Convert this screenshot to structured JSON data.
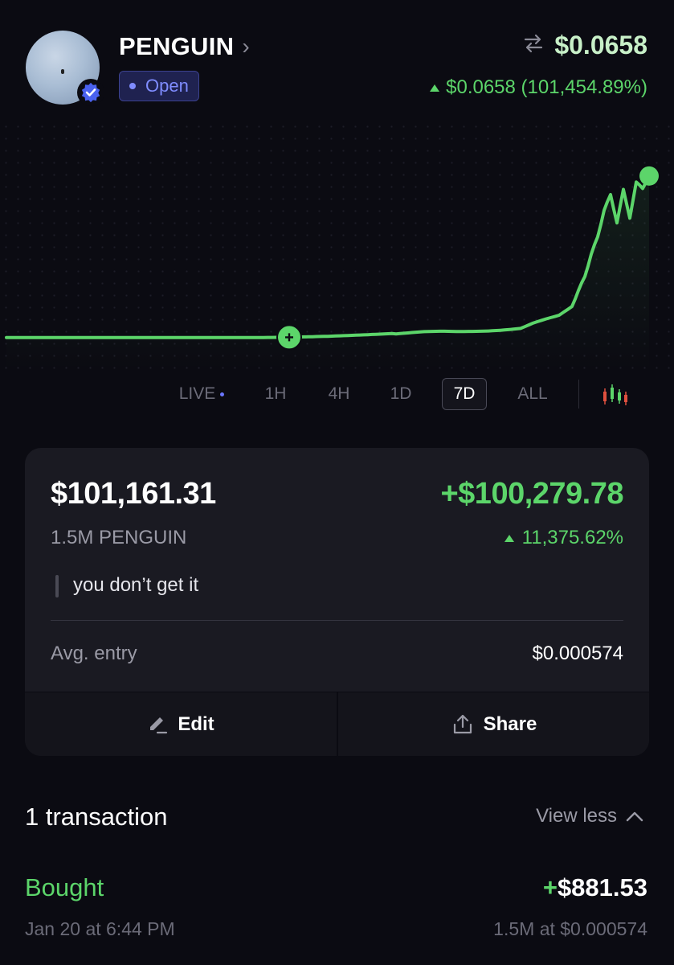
{
  "header": {
    "token_name": "PENGUIN",
    "status": "Open",
    "price": "$0.0658",
    "change": "$0.0658 (101,454.89%)"
  },
  "chart_data": {
    "type": "line",
    "title": "",
    "xlabel": "",
    "ylabel": "",
    "x": [
      0,
      10,
      20,
      30,
      40,
      44,
      50,
      55,
      60,
      65,
      70,
      75,
      80,
      82,
      84,
      86,
      88,
      89,
      90,
      91,
      92,
      93,
      94,
      95,
      96,
      97,
      98,
      99,
      100
    ],
    "values": [
      0.0001,
      0.0001,
      0.0001,
      0.0001,
      0.0001,
      0.0002,
      0.0006,
      0.0011,
      0.0017,
      0.0022,
      0.0024,
      0.0031,
      0.0038,
      0.0062,
      0.008,
      0.0095,
      0.013,
      0.019,
      0.025,
      0.034,
      0.041,
      0.052,
      0.058,
      0.047,
      0.06,
      0.049,
      0.063,
      0.061,
      0.0658
    ],
    "ylim": [
      0,
      0.07
    ],
    "entry_marker_x": 44,
    "line_color": "#5cd56a"
  },
  "timeframes": {
    "live": "LIVE",
    "h1": "1H",
    "h4": "4H",
    "d1": "1D",
    "d7": "7D",
    "all": "ALL",
    "selected": "7D"
  },
  "position": {
    "value": "$101,161.31",
    "pnl": "+$100,279.78",
    "holding": "1.5M PENGUIN",
    "pnl_pct": "11,375.62%",
    "note": "you don’t get it",
    "avg_entry_label": "Avg. entry",
    "avg_entry_value": "$0.000574",
    "edit_label": "Edit",
    "share_label": "Share"
  },
  "transactions": {
    "title": "1 transaction",
    "toggle_label": "View less",
    "items": [
      {
        "type": "Bought",
        "amount_sign": "+",
        "amount": "$881.53",
        "date": "Jan 20 at 6:44 PM",
        "detail": "1.5M at $0.000574"
      }
    ]
  },
  "colors": {
    "background": "#0b0b12",
    "accent_green": "#5cd56a",
    "badge_blue": "#7f8cff",
    "card": "#1a1a22"
  }
}
